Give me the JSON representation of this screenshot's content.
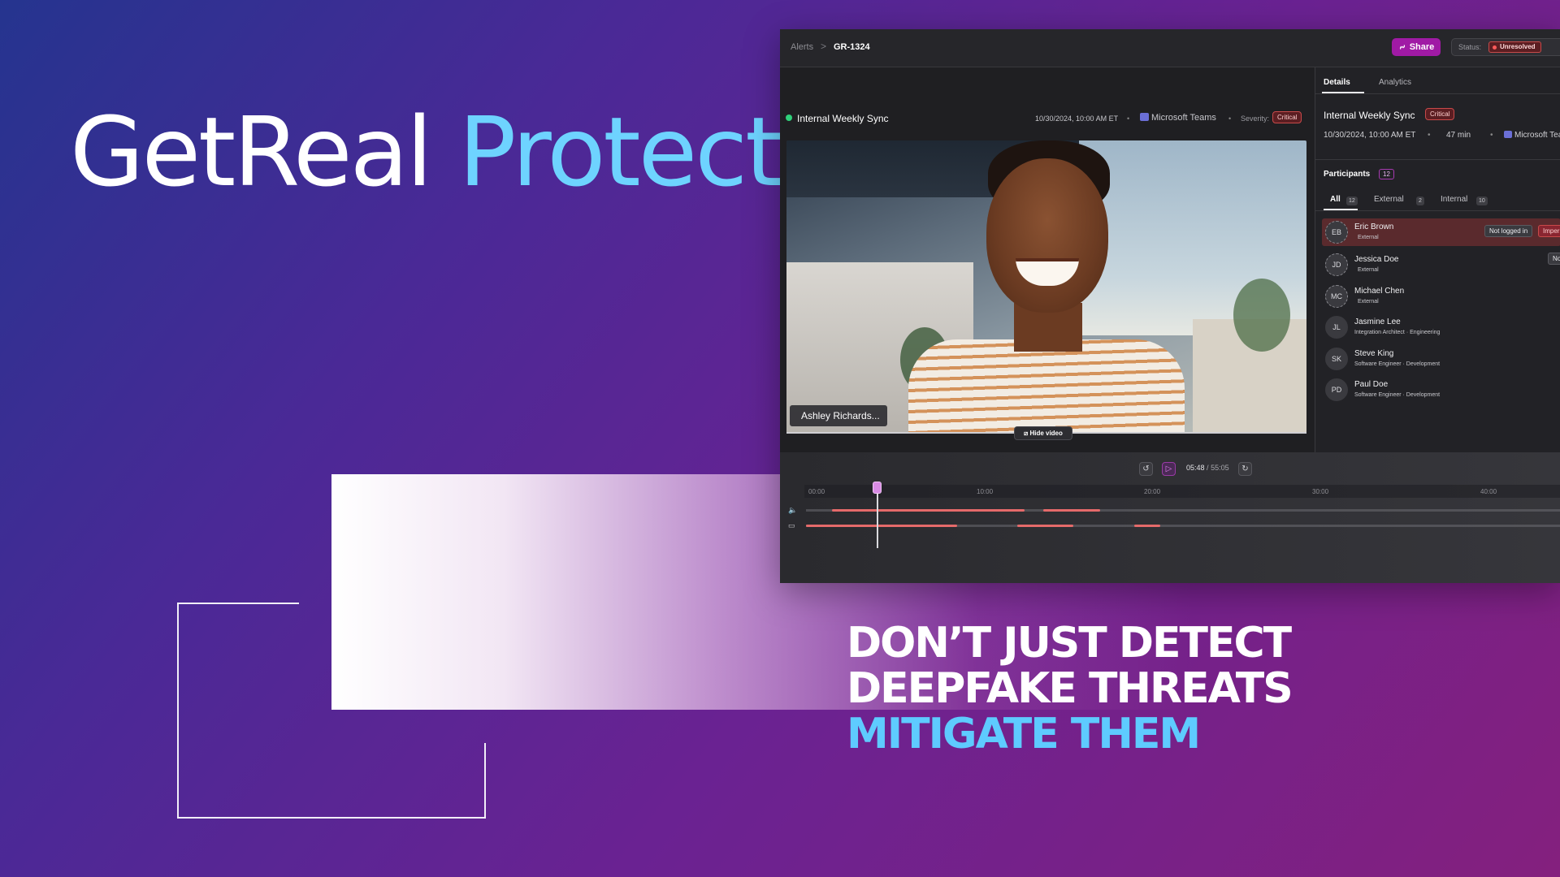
{
  "hero": {
    "title_main": "GetReal",
    "title_accent": "Protect"
  },
  "headline": {
    "line1": "DON’T JUST DETECT",
    "line2": "DEEPFAKE THREATS",
    "line3": "MITIGATE THEM"
  },
  "colors": {
    "accent_cyan": "#6ed3ff",
    "brand_magenta": "#a01aa5",
    "critical_red": "#c84a4a"
  },
  "app": {
    "breadcrumb": {
      "parent": "Alerts",
      "separator": ">",
      "current": "GR-1324"
    },
    "share_label": "Share",
    "share_icon": "link-icon",
    "status": {
      "label": "Status:",
      "value": "Unresolved"
    },
    "meeting": {
      "title": "Internal Weekly Sync",
      "datetime": "10/30/2024, 10:00 AM ET",
      "platform": "Microsoft Teams",
      "severity_label": "Severity:",
      "severity_value": "Critical",
      "separator": "•"
    },
    "video": {
      "speaker_name": "Ashley Richards...",
      "hide_video_label": "Hide video"
    },
    "side_panel": {
      "tabs": [
        "Details",
        "Analytics"
      ],
      "title": "Internal Weekly Sync",
      "severity": "Critical",
      "datetime": "10/30/2024, 10:00 AM ET",
      "duration": "47 min",
      "platform": "Microsoft Teams",
      "separator": "•",
      "participants_label": "Participants",
      "participants_count": "12",
      "filter_tabs": [
        {
          "label": "All",
          "count": "12"
        },
        {
          "label": "External",
          "count": "2"
        },
        {
          "label": "Internal",
          "count": "10"
        }
      ],
      "participants": [
        {
          "initials": "EB",
          "name": "Eric Brown",
          "role": "External",
          "tag1": "Not logged in",
          "tag2": "Impersonation"
        },
        {
          "initials": "JD",
          "name": "Jessica Doe",
          "role": "External",
          "tag1": "Not logged in"
        },
        {
          "initials": "MC",
          "name": "Michael Chen",
          "role": "External"
        },
        {
          "initials": "JL",
          "name": "Jasmine Lee",
          "role": "Integration Architect · Engineering"
        },
        {
          "initials": "SK",
          "name": "Steve King",
          "role": "Software Engineer · Development"
        },
        {
          "initials": "PD",
          "name": "Paul Doe",
          "role": "Software Engineer · Development"
        }
      ]
    },
    "player": {
      "current_time": "05:48",
      "total_time": "55:05",
      "divider": "/",
      "ticks": [
        "00:00",
        "10:00",
        "20:00",
        "30:00",
        "40:00"
      ],
      "playhead_fraction": 0.105,
      "audio_segments": [
        [
          0.035,
          0.29
        ],
        [
          0.315,
          0.39
        ]
      ],
      "video_segments": [
        [
          0.0,
          0.2
        ],
        [
          0.28,
          0.355
        ],
        [
          0.435,
          0.47
        ]
      ]
    }
  }
}
